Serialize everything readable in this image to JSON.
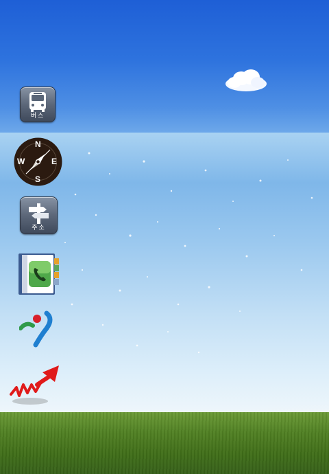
{
  "wallpaper": {
    "scene": "beach",
    "colors": {
      "sky": "#2e73de",
      "sea": "#7fb7e9",
      "sand": "#f4f6f6",
      "grass": "#4f7f22"
    }
  },
  "dock": {
    "apps": [
      {
        "id": "bus",
        "label": "버스",
        "icon": "bus-icon"
      },
      {
        "id": "compass",
        "icon": "compass-icon",
        "letters": {
          "n": "N",
          "e": "E",
          "s": "S",
          "w": "W"
        }
      },
      {
        "id": "address",
        "label": "주소",
        "icon": "signpost-icon"
      },
      {
        "id": "contacts",
        "icon": "phone-book-icon"
      },
      {
        "id": "seoul",
        "icon": "seoul-logo-icon"
      },
      {
        "id": "stocks",
        "icon": "stock-chart-icon"
      }
    ]
  }
}
